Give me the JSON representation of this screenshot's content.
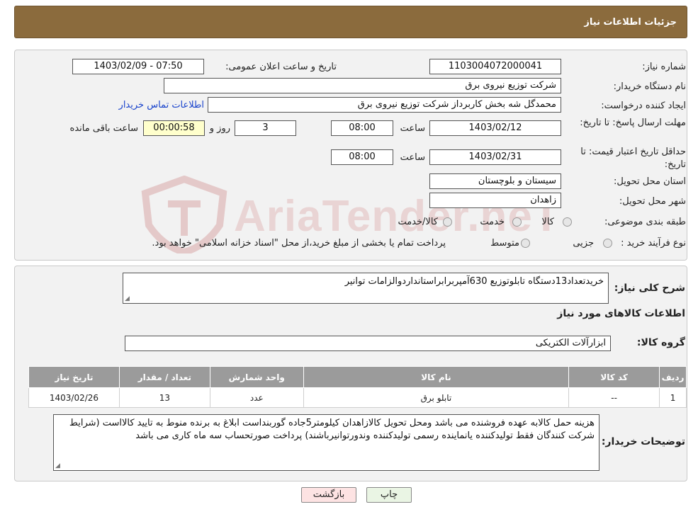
{
  "header": {
    "title": "جزئیات اطلاعات نیاز"
  },
  "fields": {
    "need_number_label": "شماره نیاز:",
    "need_number": "1103004072000041",
    "announce_label": "تاریخ و ساعت اعلان عمومی:",
    "announce_value": "1403/02/09 - 07:50",
    "buyer_label": "نام دستگاه خریدار:",
    "buyer": "شرکت توزیع نیروی برق",
    "creator_label": "ایجاد کننده درخواست:",
    "creator": "محمدگل شه بخش کاربرداز شرکت توزیع نیروی برق",
    "contact_link": "اطلاعات تماس خریدار",
    "deadline_label": "مهلت ارسال پاسخ: تا تاریخ:",
    "deadline_date": "1403/02/12",
    "time_label": "ساعت",
    "deadline_time": "08:00",
    "days": "3",
    "days_label": "روز و",
    "remaining": "00:00:58",
    "remaining_label": "ساعت باقی مانده",
    "validity_label": "حداقل تاریخ اعتبار قیمت: تا تاریخ:",
    "validity_date": "1403/02/31",
    "validity_time": "08:00",
    "province_label": "استان محل تحویل:",
    "province": "سیستان و بلوچستان",
    "city_label": "شهر محل تحویل:",
    "city": "زاهدان",
    "category_label": "طبقه بندی موضوعی:",
    "category_options": [
      "کالا",
      "خدمت",
      "کالا/خدمت"
    ],
    "process_label": "نوع فرآیند خرید :",
    "process_options": [
      "جزیی",
      "متوسط"
    ],
    "process_note": "پرداخت تمام یا بخشی از مبلغ خرید،از محل \"اسناد خزانه اسلامی\" خواهد بود."
  },
  "description": {
    "label": "شرح کلی نیاز:",
    "text": "خریدتعداد13دستگاه تابلوتوزیع 630آمپربرابراستانداردوالزامات توانیر"
  },
  "goods": {
    "section_title": "اطلاعات کالاهای مورد نیاز",
    "group_label": "گروه کالا:",
    "group_value": "ابزارآلات الکتریکی",
    "columns": [
      "ردیف",
      "کد کالا",
      "نام کالا",
      "واحد شمارش",
      "تعداد / مقدار",
      "تاریخ نیاز"
    ],
    "rows": [
      {
        "row": "1",
        "code": "--",
        "name": "تابلو برق",
        "unit": "عدد",
        "qty": "13",
        "date": "1403/02/26"
      }
    ]
  },
  "buyer_notes": {
    "label": "توضیحات خریدار:",
    "text": "هزینه حمل کالابه عهده فروشنده می باشد ومحل تحویل کالازاهدان کیلومتر5جاده گوربنداست ابلاغ به برنده منوط به تایید کالااست (شرایط شرکت کنندگان فقط تولیدکننده یانماینده رسمی تولیدکننده وندورتوانیرباشند) پرداخت صورتحساب سه ماه کاری می باشد"
  },
  "buttons": {
    "print": "چاپ",
    "back": "بازگشت"
  },
  "watermark": {
    "text": "AriaTender.neT",
    "color": "#d9a8a8"
  },
  "colors": {
    "header": "#8B6B3D",
    "link": "#1a44cc",
    "table_header": "#9b9b9b"
  }
}
